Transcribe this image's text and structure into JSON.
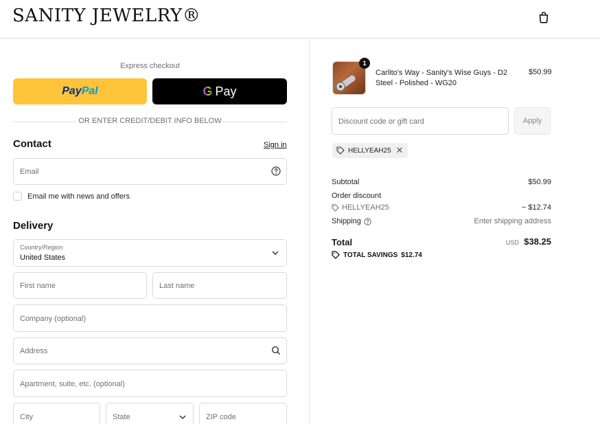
{
  "header": {
    "brand": "SANITY JEWELRY®",
    "cart_icon": "shopping-bag-icon"
  },
  "express": {
    "label": "Express checkout",
    "paypal_label_1": "Pay",
    "paypal_label_2": "Pal",
    "gpay_g": "G",
    "gpay_label": "Pay",
    "divider_text": "OR ENTER CREDIT/DEBIT INFO BELOW"
  },
  "contact": {
    "title": "Contact",
    "signin": "Sign in",
    "email_placeholder": "Email",
    "newsletter_label": "Email me with news and offers"
  },
  "delivery": {
    "title": "Delivery",
    "country_label": "Country/Region",
    "country_value": "United States",
    "first_name": "First name",
    "last_name": "Last name",
    "company": "Company (optional)",
    "address": "Address",
    "apartment": "Apartment, suite, etc. (optional)",
    "city": "City",
    "state": "State",
    "zip": "ZIP code"
  },
  "order": {
    "item": {
      "quantity": "1",
      "name": "Carlito's Way - Sanity's Wise Guys - D2 Steel - Polished - WG20",
      "price": "$50.99"
    },
    "discount_placeholder": "Discount code or gift card",
    "apply_label": "Apply",
    "applied_code": "HELLYEAH25",
    "subtotal_label": "Subtotal",
    "subtotal_value": "$50.99",
    "order_discount_label": "Order discount",
    "discount_code": "HELLYEAH25",
    "discount_value": "− $12.74",
    "shipping_label": "Shipping",
    "shipping_value": "Enter shipping address",
    "total_label": "Total",
    "currency": "USD",
    "total_value": "$38.25",
    "savings_label": "TOTAL SAVINGS",
    "savings_value": "$12.74"
  },
  "colors": {
    "paypal_yellow": "#ffc439",
    "gpay_black": "#000000",
    "border": "#d9d9d9"
  }
}
